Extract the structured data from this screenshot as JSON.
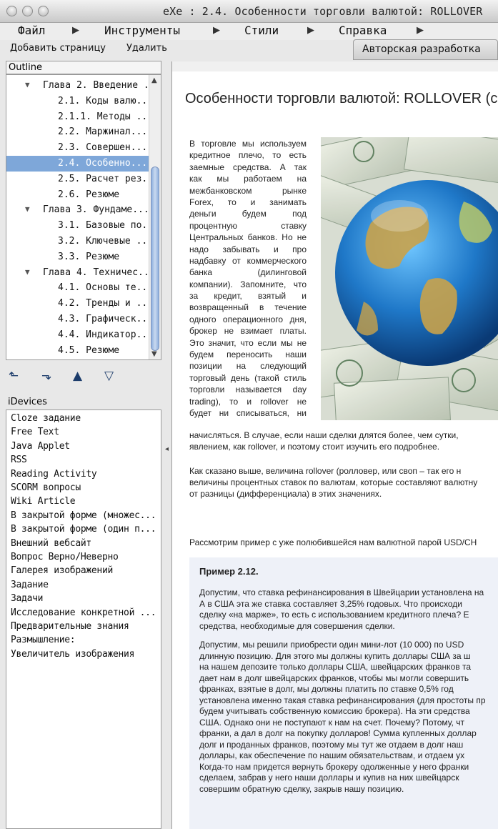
{
  "window": {
    "title": "eXe : 2.4. Особенности торговли валютой: ROLLOVER"
  },
  "menu": {
    "file": "Файл",
    "tools": "Инструменты",
    "styles": "Стили",
    "help": "Справка"
  },
  "toolbar": {
    "add_page": "Добавить страницу",
    "delete": "Удалить",
    "authoring_tab": "Авторская разработка"
  },
  "outline": {
    "header": "Outline",
    "items": [
      {
        "label": "Глава 2. Введение ...",
        "level": 1,
        "expanded": true
      },
      {
        "label": "2.1. Коды валю...",
        "level": 2
      },
      {
        "label": "2.1.1. Методы ...",
        "level": 2
      },
      {
        "label": "2.2. Маржинал...",
        "level": 2
      },
      {
        "label": "2.3. Совершен...",
        "level": 2
      },
      {
        "label": "2.4. Особенно...",
        "level": 2,
        "selected": true
      },
      {
        "label": "2.5. Расчет рез...",
        "level": 2
      },
      {
        "label": "2.6. Резюме",
        "level": 2
      },
      {
        "label": "Глава 3. Фундаме...",
        "level": 1,
        "expanded": true
      },
      {
        "label": "3.1. Базовые по...",
        "level": 2
      },
      {
        "label": "3.2. Ключевые ...",
        "level": 2
      },
      {
        "label": "3.3. Резюме",
        "level": 2
      },
      {
        "label": "Глава 4. Техничес...",
        "level": 1,
        "expanded": true
      },
      {
        "label": "4.1. Основы те...",
        "level": 2
      },
      {
        "label": "4.2. Тренды и ...",
        "level": 2
      },
      {
        "label": "4.3. Графическ...",
        "level": 2
      },
      {
        "label": "4.4. Индикатор...",
        "level": 2
      },
      {
        "label": "4.5. Резюме",
        "level": 2
      }
    ]
  },
  "idevices": {
    "header": "iDevices",
    "items": [
      "Cloze задание",
      "Free Text",
      "Java Applet",
      "RSS",
      "Reading Activity",
      "SCORM вопросы",
      "Wiki Article",
      "В закрытой форме (множес...",
      "В закрытой форме (один п...",
      "Внешний вебсайт",
      "Вопрос Верно/Неверно",
      "Галерея изображений",
      "Задание",
      "Задачи",
      "Исследование конкретной ...",
      "Предварительные знания",
      "Размышление:",
      "Увеличитель изображения"
    ]
  },
  "content": {
    "title": "Особенности торговли валютой: ROLLOVER (с",
    "narrow_lines": [
      "В торговле мы используем",
      "кредитное плечо, то есть",
      "заемные средства. А так",
      "как мы работаем на",
      "межбанковском рынке",
      "Forex, то и занимать",
      "деньги будем под",
      "процентную ставку",
      "Центральных банков. Но не",
      "надо забывать и про",
      "надбавку от коммерческого",
      "банка (дилинговой",
      "компании). Запомните, что",
      "за кредит, взятый и",
      "возвращенный в течение",
      "одного операционного дня,",
      "брокер не взимает платы.",
      "Это значит, что если мы не",
      "будем переносить наши",
      "позиции на следующий",
      "торговый день (такой стиль",
      "торговли называется day",
      "trading), то и rollover не",
      "будет ни списываться, ни"
    ],
    "wide_lines_1": [
      "начисляться. В случае, если наши сделки длятся более, чем сутки,",
      "явлением, как rollover, и поэтому стоит изучить его подробнее."
    ],
    "wide_lines_2": [
      "Как сказано выше, величина rollover (ролловер, или своп – так его н",
      "величины процентных ставок по валютам, которые составляют валютну",
      "от разницы (дифференциала) в этих значениях."
    ],
    "wide_lines_3": [
      "Рассмотрим пример с уже полюбившейся нам валютной парой USD/CH"
    ],
    "example": {
      "title": "Пример 2.12.",
      "para1": [
        "Допустим, что ставка рефинансирования в Швейцарии установлена на",
        "А в США эта же ставка составляет 3,25% годовых. Что происходи",
        "сделку «на марже», то есть с использованием кредитного плеча? Е",
        "средства, необходимые для совершения сделки."
      ],
      "para2": [
        "Допустим, мы решили приобрести один мини-лот (10 000) по USD",
        "длинную позицию. Для этого мы должны купить доллары США за ш",
        "на нашем депозите только доллары США, швейцарских франков та",
        "дает нам в долг швейцарских франков, чтобы мы могли совершить",
        "франках, взятые в долг, мы должны платить по ставке 0,5% год",
        "установлена именно такая ставка рефинансирования (для простоты пр",
        "будем учитывать собственную комиссию брокера). На эти средства",
        "США. Однако они не поступают к нам на счет. Почему? Потому, чт",
        "франки, а дал в долг на покупку долларов! Сумма купленных доллар",
        "долг и проданных франков, поэтому мы тут же отдаем в долг наш",
        "доллары, как обеспечение по нашим обязательствам, и отдаем ух",
        "Когда-то нам придется вернуть брокеру одолженные у него франки",
        "сделаем, забрав у него наши доллары и купив на них швейцарск",
        "совершим обратную сделку, закрыв нашу позицию."
      ]
    }
  }
}
